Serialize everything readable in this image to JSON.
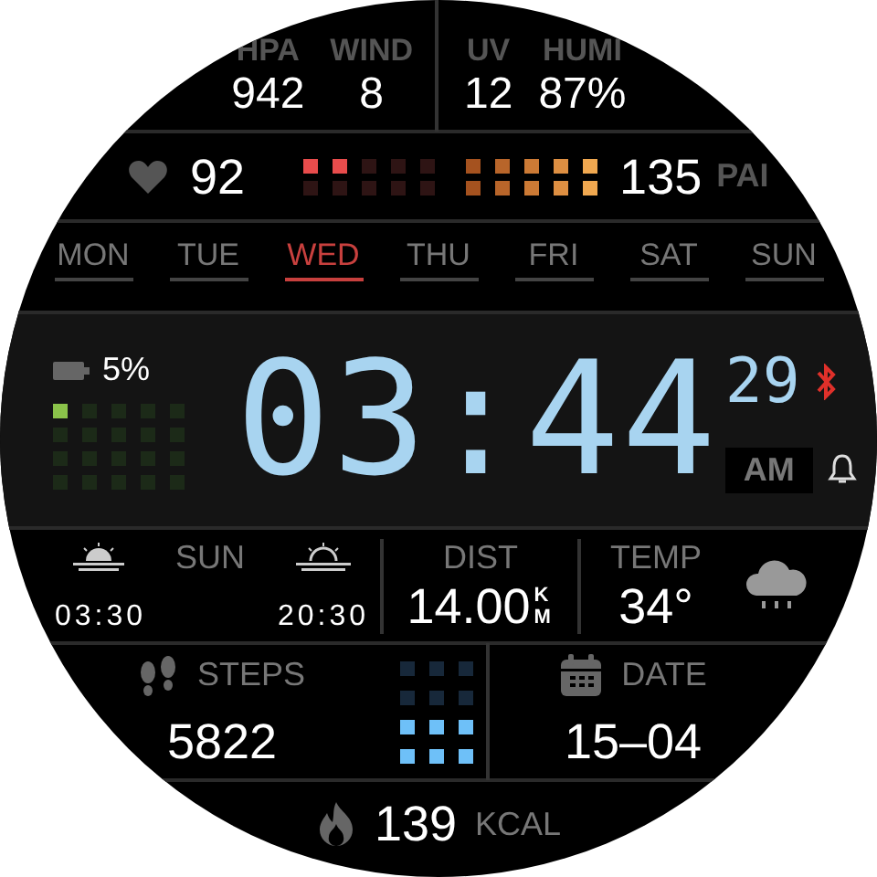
{
  "weather": [
    {
      "label": "HPA",
      "value": "942"
    },
    {
      "label": "WIND",
      "value": "8"
    },
    {
      "label": "UV",
      "value": "12"
    },
    {
      "label": "HUMI",
      "value": "87%"
    }
  ],
  "heart": {
    "value": "92",
    "level": 0.2
  },
  "pai": {
    "value": "135",
    "label": "PAI",
    "level": 1
  },
  "days": [
    {
      "label": "MON",
      "selected": false
    },
    {
      "label": "TUE",
      "selected": false
    },
    {
      "label": "WED",
      "selected": true
    },
    {
      "label": "THU",
      "selected": false
    },
    {
      "label": "FRI",
      "selected": false
    },
    {
      "label": "SAT",
      "selected": false
    },
    {
      "label": "SUN",
      "selected": false
    }
  ],
  "battery": {
    "reading": "5%",
    "level": 0.05
  },
  "time": {
    "hours_minutes": "03:44",
    "seconds": "29",
    "period": "AM"
  },
  "sun": {
    "label": "SUN",
    "sunrise": "03:30",
    "sunset": "20:30"
  },
  "distance": {
    "label": "DIST",
    "value": "14.00",
    "unit": "KM"
  },
  "temperature": {
    "label": "TEMP",
    "value": "34°"
  },
  "steps": {
    "label": "STEPS",
    "value": "5822",
    "level": 0.5
  },
  "date": {
    "label": "DATE",
    "value": "15–04"
  },
  "calories": {
    "value": "139",
    "unit": "KCAL"
  }
}
